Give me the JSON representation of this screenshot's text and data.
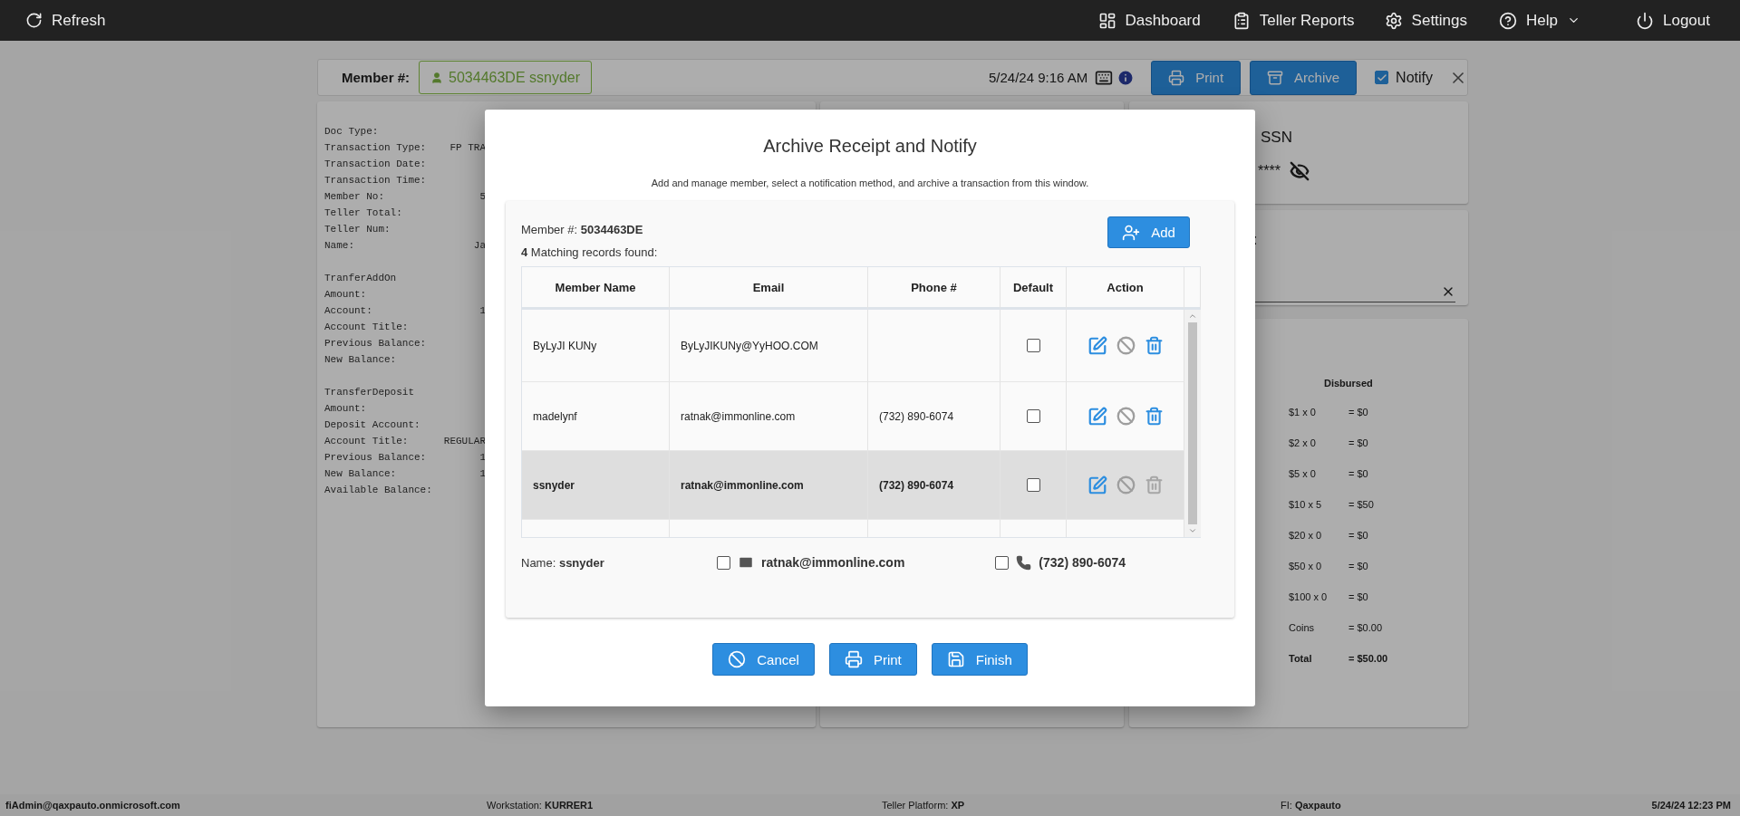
{
  "top_nav": {
    "refresh": "Refresh",
    "items": [
      {
        "label": "Dashboard",
        "kind": "dashboard",
        "dropdown": false
      },
      {
        "label": "Teller Reports",
        "kind": "reports",
        "dropdown": false
      },
      {
        "label": "Settings",
        "kind": "settings",
        "dropdown": false
      },
      {
        "label": "Help",
        "kind": "help",
        "dropdown": true
      },
      {
        "label": "Logout",
        "kind": "logout",
        "dropdown": false
      }
    ]
  },
  "member_header": {
    "label": "Member #:",
    "member_chip": "5034463DE ssnyder",
    "datetime": "5/24/24 9:16 AM",
    "buttons": [
      {
        "label": "Print",
        "kind": "print"
      },
      {
        "label": "Archive",
        "kind": "archive"
      }
    ],
    "notify": {
      "label": "Notify",
      "checked": true
    }
  },
  "receipt": {
    "sections": [
      {
        "lines": [
          {
            "label": "Doc Type:"
          },
          {
            "label": "Transaction Type:",
            "value": "FP TRA"
          },
          {
            "label": "Transaction Date:"
          },
          {
            "label": "Transaction Time:"
          },
          {
            "label": "Member No:",
            "value": "5"
          },
          {
            "label": "Teller Total:"
          },
          {
            "label": "Teller Num:"
          },
          {
            "label": "Name:",
            "value": "Ja"
          }
        ]
      },
      {
        "heading": "TranferAddOn",
        "lines": [
          {
            "label": "Amount:"
          },
          {
            "label": "Account:",
            "value": "1"
          },
          {
            "label": "Account Title:"
          },
          {
            "label": "Previous Balance:"
          },
          {
            "label": "New Balance:"
          }
        ]
      },
      {
        "heading": "TransferDeposit",
        "lines": [
          {
            "label": "Amount:"
          },
          {
            "label": "Deposit Account:"
          },
          {
            "label": "Account Title:",
            "value": "REGULAR"
          },
          {
            "label": "Previous Balance:",
            "value": "1"
          },
          {
            "label": "New Balance:",
            "value": "1"
          },
          {
            "label": "Available Balance:"
          }
        ]
      }
    ]
  },
  "ssn_card": {
    "title": "SSN",
    "masked": "****"
  },
  "field_card": {
    "label": ":"
  },
  "disbursed": {
    "title": "Disbursed",
    "rows": [
      {
        "denomination": "$1 x 0",
        "amount": "= $0",
        "total": false
      },
      {
        "denomination": "$2 x 0",
        "amount": "= $0",
        "total": false
      },
      {
        "denomination": "$5 x 0",
        "amount": "= $0",
        "total": false
      },
      {
        "denomination": "$10 x 5",
        "amount": "= $50",
        "total": false
      },
      {
        "denomination": "$20 x 0",
        "amount": "= $0",
        "total": false
      },
      {
        "denomination": "$50 x 0",
        "amount": "= $0",
        "total": false
      },
      {
        "denomination": "$100 x 0",
        "amount": "= $0",
        "total": false
      },
      {
        "denomination": "Coins",
        "amount": "= $0.00",
        "total": false
      },
      {
        "denomination": "Total",
        "amount": "= $50.00",
        "total": true
      }
    ]
  },
  "modal": {
    "title": "Archive Receipt and Notify",
    "subtitle": "Add and manage member, select a notification method, and archive a transaction from this window.",
    "member_line": "Member #: **5034463DE**",
    "add_button": "Add",
    "match_line": "**4** Matching records found:",
    "table": {
      "columns": [
        "Member Name",
        "Email",
        "Phone #",
        "Default",
        "Action"
      ],
      "rows": [
        {
          "name": "ByLyJI KUNy",
          "email": "ByLyJIKUNy@YyHOO.COM",
          "default": false,
          "selected": false,
          "delete_disabled": false
        },
        {
          "name": "madelynf",
          "email": "ratnak@immonline.com",
          "phone": "(732) 890-6074",
          "default": false,
          "selected": false,
          "delete_disabled": false
        },
        {
          "name": "ssnyder",
          "email": "ratnak@immonline.com",
          "phone": "(732) 890-6074",
          "default": false,
          "selected": true,
          "delete_disabled": true
        }
      ]
    },
    "name_line": "Name: **ssnyder**",
    "email_option": {
      "value": "ratnak@immonline.com",
      "checked": false
    },
    "phone_option": {
      "value": "(732) 890-6074",
      "checked": false
    },
    "buttons": [
      {
        "label": "Cancel",
        "kind": "cancel"
      },
      {
        "label": "Print",
        "kind": "print"
      },
      {
        "label": "Finish",
        "kind": "finish"
      }
    ]
  },
  "status_bar": {
    "user": "fiAdmin@qaxpauto.onmicrosoft.com",
    "workstation": "Workstation: **KURRER1**",
    "platform": "Teller Platform: **XP**",
    "fi": "FI: **Qaxpauto**",
    "datetime": "5/24/24 12:23 PM"
  }
}
